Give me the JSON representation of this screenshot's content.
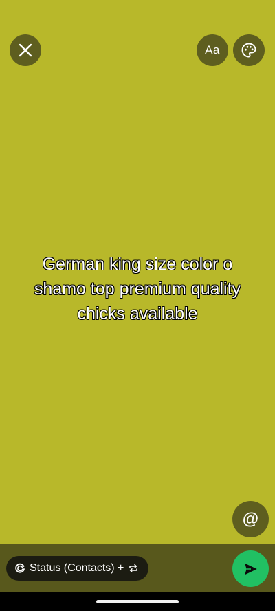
{
  "canvas": {
    "background_color": "#b8b82a",
    "status_lines": [
      "German king size color o",
      "shamo top premium quality",
      "chicks available"
    ]
  },
  "toolbar": {
    "close_icon": "close-icon",
    "text_label": "Aa",
    "palette_icon": "palette-icon"
  },
  "mention": {
    "label": "@"
  },
  "bottom_bar": {
    "audience_label": "Status (Contacts) +",
    "audience_icon": "status-ring-icon",
    "repeat_icon": "repeat-icon",
    "send_icon": "send-icon",
    "send_color": "#21c063"
  }
}
